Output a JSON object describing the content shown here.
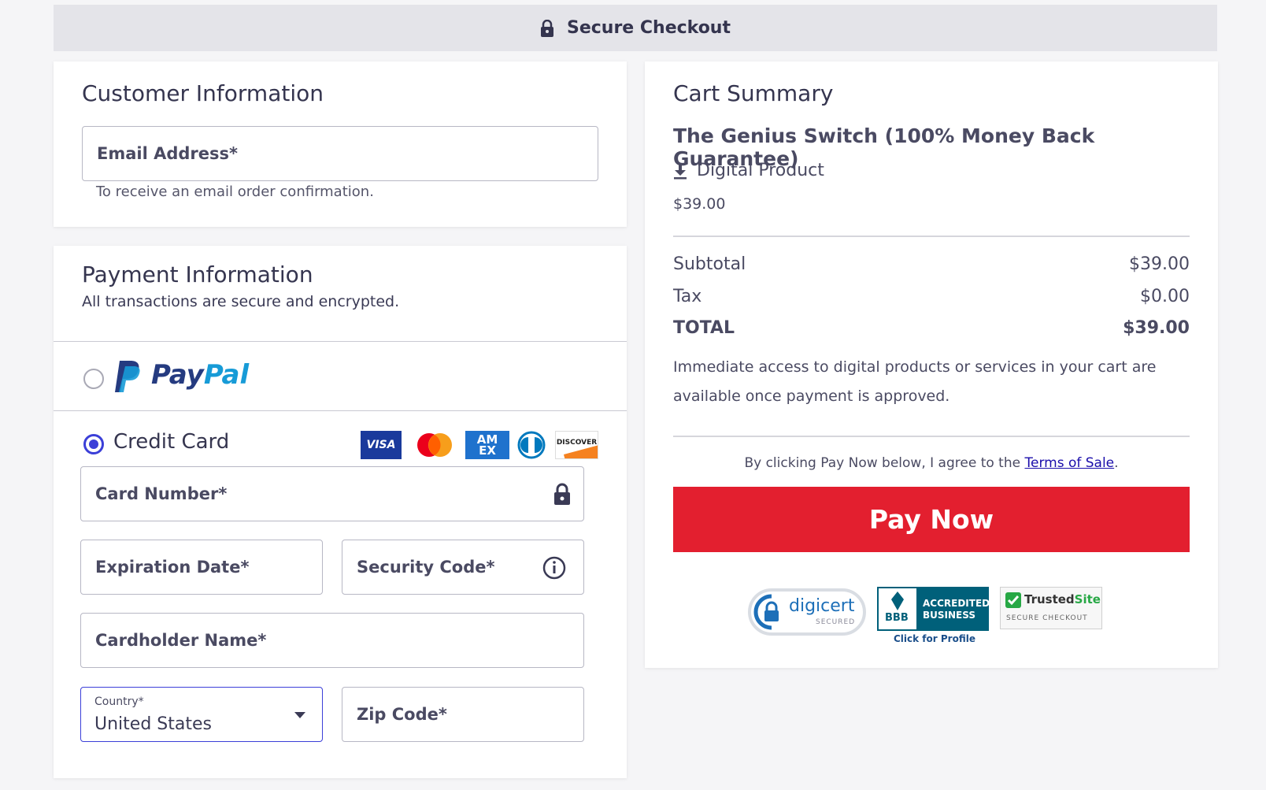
{
  "header": {
    "title": "Secure Checkout",
    "icon": "lock-icon"
  },
  "customer": {
    "title": "Customer Information",
    "email_label": "Email Address*",
    "email_hint": "To receive an email order confirmation."
  },
  "payment": {
    "title": "Payment Information",
    "subtitle": "All transactions are secure and encrypted.",
    "paypal": {
      "word_pay": "Pay",
      "word_pal": "Pal",
      "selected": false
    },
    "credit_card": {
      "label": "Credit Card",
      "selected": true,
      "brands": {
        "visa": "VISA",
        "amex_top": "AM",
        "amex_bottom": "EX",
        "discover": "DISCOVER"
      }
    },
    "fields": {
      "card_number": "Card Number*",
      "expiration": "Expiration Date*",
      "security": "Security Code*",
      "cardholder": "Cardholder Name*",
      "country_label": "Country*",
      "country_value": "United States",
      "zip": "Zip Code*"
    }
  },
  "cart": {
    "title": "Cart Summary",
    "product_name": "The Genius Switch (100% Money Back Guarantee)",
    "product_type": "Digital Product",
    "product_price": "$39.00",
    "subtotal_label": "Subtotal",
    "subtotal_value": "$39.00",
    "tax_label": "Tax",
    "tax_value": "$0.00",
    "total_label": "TOTAL",
    "total_value": "$39.00",
    "note": "Immediate access to digital products or services in your cart are available once payment is approved.",
    "agree_prefix": "By clicking Pay Now below, I agree to the ",
    "agree_link": "Terms of Sale",
    "agree_suffix": ".",
    "pay_button": "Pay Now",
    "badges": {
      "digicert": "digicert",
      "digicert_sub": "SECURED",
      "bbb_line1": "ACCREDITED",
      "bbb_line2": "BUSINESS",
      "bbb_mark": "BBB",
      "bbb_caption": "Click for Profile",
      "trusted_a": "Trusted",
      "trusted_b": "Site",
      "trusted_sub": "SECURE CHECKOUT"
    }
  },
  "colors": {
    "accent": "#3b3fd8",
    "pay_button": "#e31f2f",
    "link": "#1a0dab"
  }
}
